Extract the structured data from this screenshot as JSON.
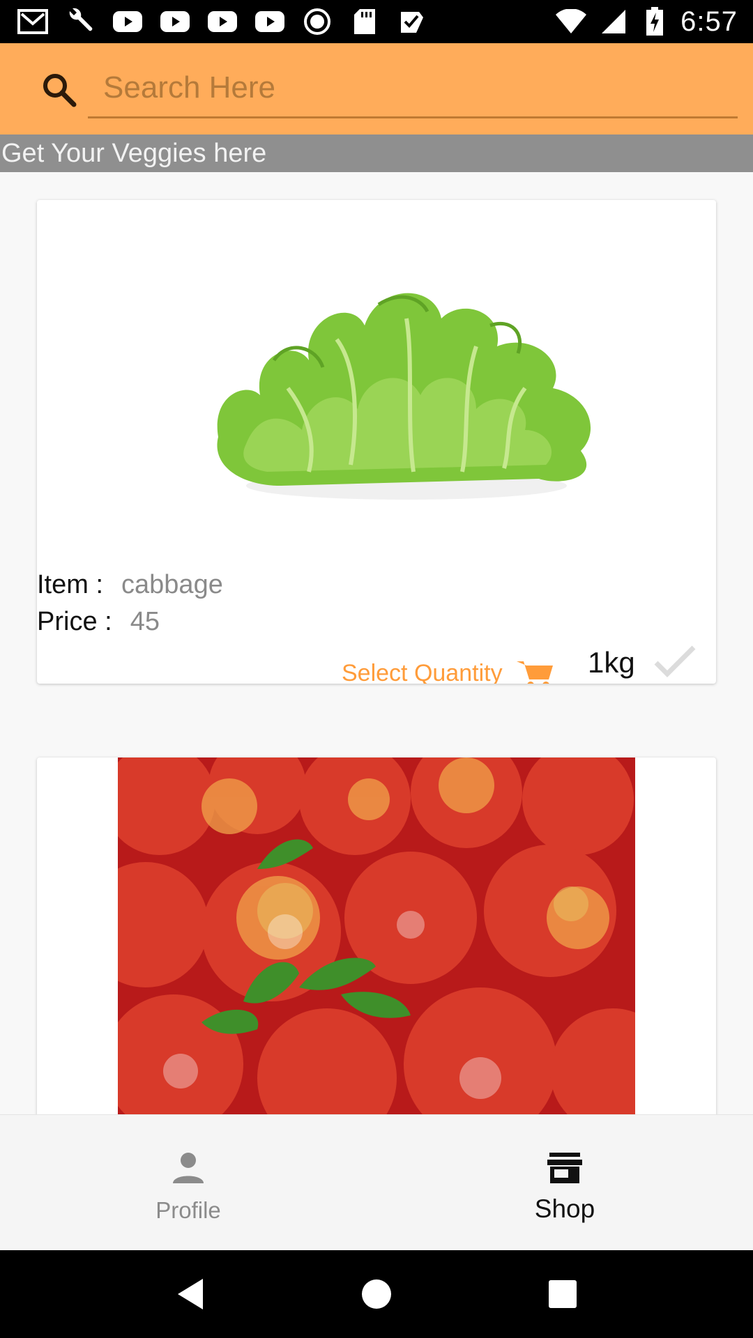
{
  "status_bar": {
    "time": "6:57",
    "icons": [
      "gmail-icon",
      "wrench-icon",
      "youtube-icon",
      "youtube-icon",
      "youtube-icon",
      "youtube-icon",
      "record-icon",
      "sd-card-icon",
      "check-box-icon",
      "wifi-icon",
      "signal-icon",
      "battery-charging-icon"
    ]
  },
  "search": {
    "placeholder": "Search Here",
    "value": ""
  },
  "banner": {
    "text": "Get Your Veggies here"
  },
  "products": [
    {
      "item_label": "Item :",
      "item_value": "cabbage",
      "price_label": "Price :",
      "price_value": "45",
      "select_quantity_label": "Select Quantity",
      "quantity": "1kg",
      "image": "lettuce-image"
    },
    {
      "image": "apples-image"
    }
  ],
  "bottom_nav": {
    "items": [
      {
        "label": "Profile",
        "icon": "person-icon",
        "active": false
      },
      {
        "label": "Shop",
        "icon": "store-icon",
        "active": true
      }
    ]
  },
  "colors": {
    "accent": "#ffac5a",
    "banner": "#8f8f8f",
    "select_quantity": "#ff9c3a"
  }
}
